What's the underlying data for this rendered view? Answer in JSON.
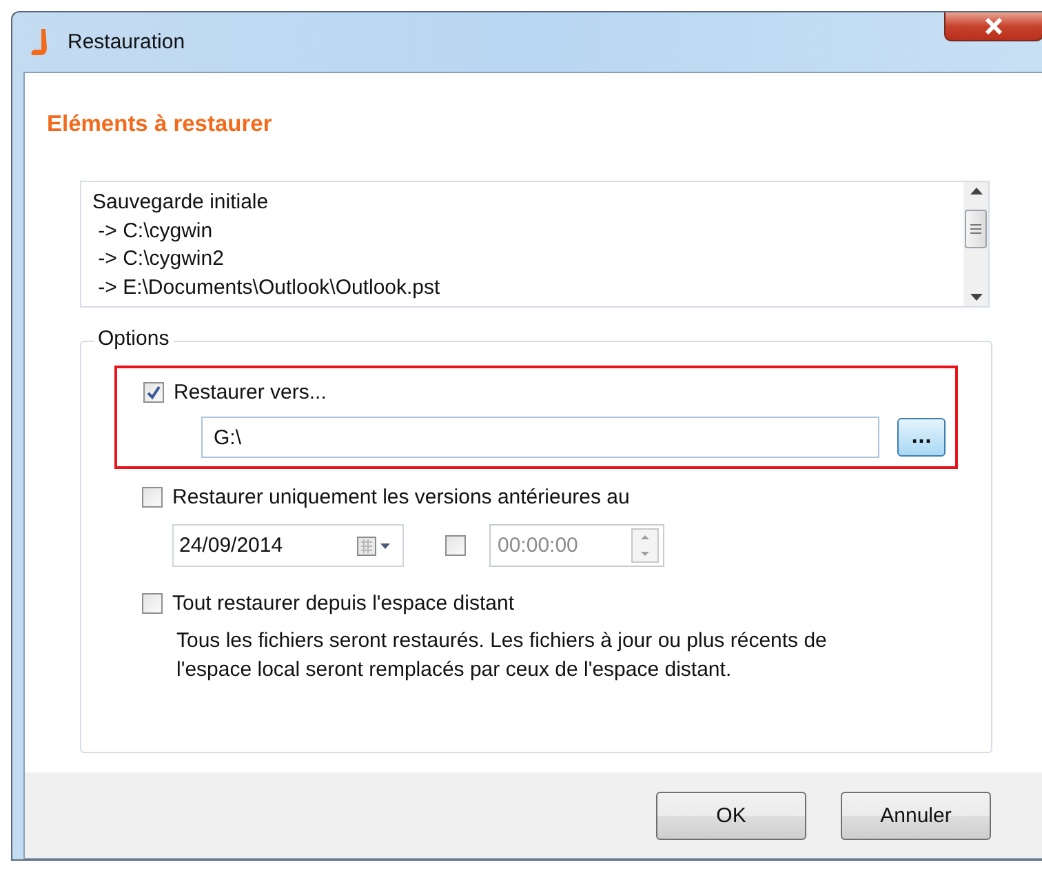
{
  "window": {
    "title": "Restauration"
  },
  "heading": "Eléments à restaurer",
  "backup_list": [
    "Sauvegarde initiale",
    " -> C:\\cygwin",
    " -> C:\\cygwin2",
    " -> E:\\Documents\\Outlook\\Outlook.pst"
  ],
  "options": {
    "legend": "Options",
    "restore_to": {
      "label": "Restaurer vers...",
      "checked": true,
      "highlighted": true,
      "path": "G:\\",
      "browse_label": "..."
    },
    "before_date": {
      "label": "Restaurer uniquement les versions antérieures au",
      "checked": false,
      "date": "24/09/2014",
      "time_checked": false,
      "time": "00:00:00",
      "time_disabled": true
    },
    "remote": {
      "label": "Tout restaurer depuis l'espace distant",
      "checked": false,
      "description": "Tous les fichiers seront restaurés. Les fichiers à jour ou plus récents de l'espace local seront remplacés par ceux de l'espace distant."
    }
  },
  "buttons": [
    "OK",
    "Annuler"
  ]
}
